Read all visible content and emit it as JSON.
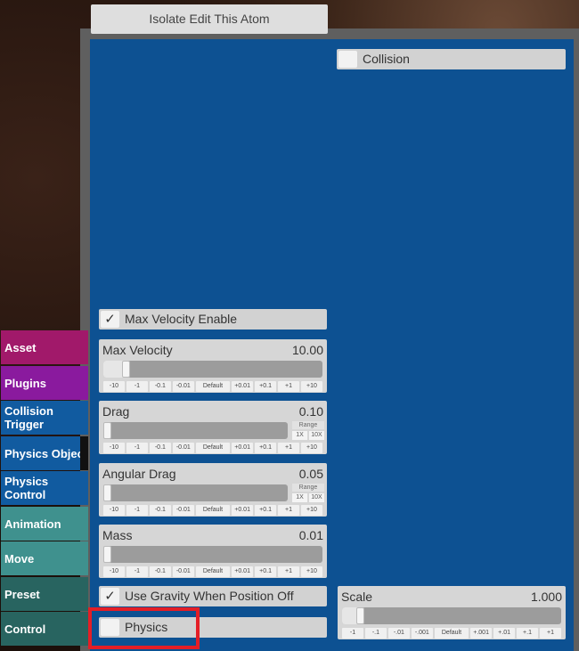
{
  "top_button": {
    "label": "Isolate Edit This Atom"
  },
  "collision_toggle": {
    "label": "Collision",
    "checked": false
  },
  "max_velocity_enable": {
    "label": "Max Velocity Enable",
    "checked": true,
    "check_glyph": "✓"
  },
  "use_gravity": {
    "label": "Use Gravity When Position Off",
    "checked": true,
    "check_glyph": "✓"
  },
  "physics_toggle": {
    "label": "Physics",
    "checked": false
  },
  "range": {
    "title": "Range",
    "one_x": "1X",
    "ten_x": "10X"
  },
  "sliders": {
    "max_velocity": {
      "label": "Max Velocity",
      "value": "10.00",
      "fill_fraction": 0.12,
      "steps": [
        "-10",
        "-1",
        "-0.1",
        "-0.01",
        "Default",
        "+0.01",
        "+0.1",
        "+1",
        "+10"
      ]
    },
    "drag": {
      "label": "Drag",
      "value": "0.10",
      "fill_fraction": 0.01,
      "steps": [
        "-10",
        "-1",
        "-0.1",
        "-0.01",
        "Default",
        "+0.01",
        "+0.1",
        "+1",
        "+10"
      ]
    },
    "angular_drag": {
      "label": "Angular Drag",
      "value": "0.05",
      "fill_fraction": 0.01,
      "steps": [
        "-10",
        "-1",
        "-0.1",
        "-0.01",
        "Default",
        "+0.01",
        "+0.1",
        "+1",
        "+10"
      ]
    },
    "mass": {
      "label": "Mass",
      "value": "0.01",
      "fill_fraction": 0.0,
      "steps": [
        "-10",
        "-1",
        "-0.1",
        "-0.01",
        "Default",
        "+0.01",
        "+0.1",
        "+1",
        "+10"
      ]
    },
    "scale": {
      "label": "Scale",
      "value": "1.000",
      "fill_fraction": 0.1,
      "steps": [
        "-1",
        "-.1",
        "-.01",
        "-.001",
        "Default",
        "+.001",
        "+.01",
        "+.1",
        "+1"
      ]
    }
  },
  "tabs": [
    {
      "label": "Asset",
      "color": "#a1196a"
    },
    {
      "label": "Plugins",
      "color": "#8a1a9e"
    },
    {
      "label": "Collision Trigger",
      "color": "#115ba0"
    },
    {
      "label": "Physics Object",
      "color": "#115ba0",
      "active": true
    },
    {
      "label": "Physics Control",
      "color": "#115ba0"
    },
    {
      "label": "Animation",
      "color": "#3f918e"
    },
    {
      "label": "Move",
      "color": "#3f918e"
    },
    {
      "label": "Preset",
      "color": "#286460"
    },
    {
      "label": "Control",
      "color": "#286460"
    }
  ],
  "colors": {
    "panel": "#0d5192",
    "highlight": "#e41e26"
  }
}
